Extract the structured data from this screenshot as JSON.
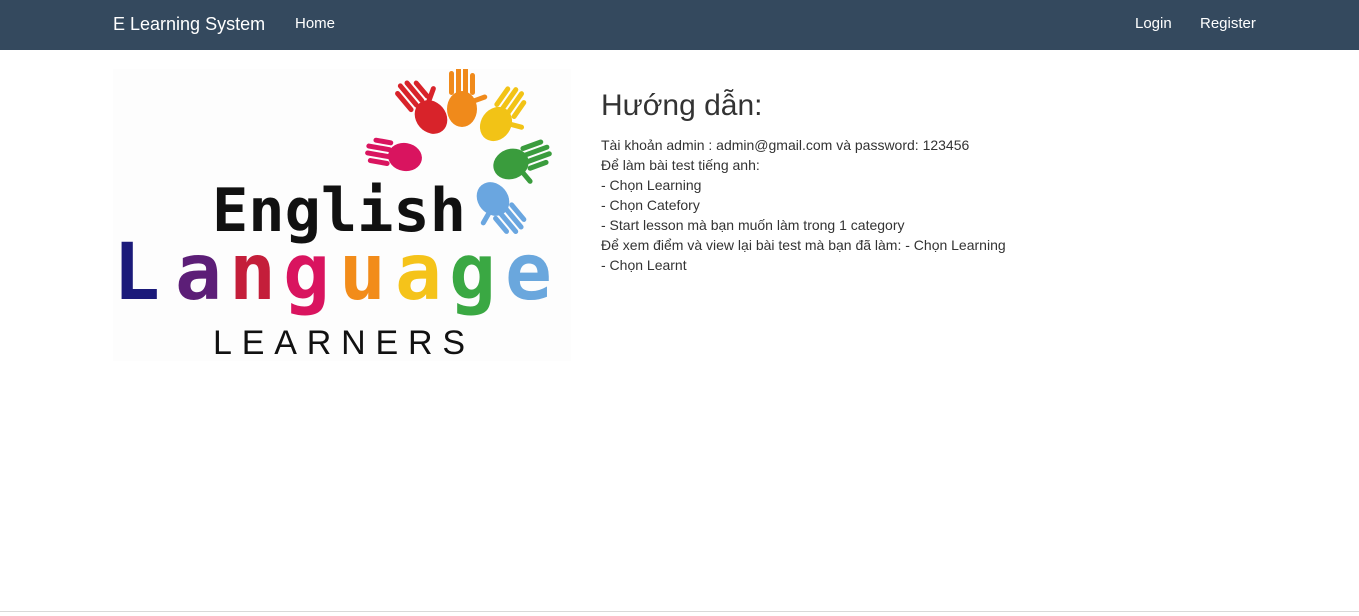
{
  "navbar": {
    "brand": "E Learning System",
    "home": "Home",
    "login": "Login",
    "register": "Register",
    "background_color": "#34495e"
  },
  "logo": {
    "word1": "English",
    "word2_letters": [
      "L",
      "a",
      "n",
      "g",
      "u",
      "a",
      "g",
      "e"
    ],
    "word3": "LEARNERS",
    "letter_colors": [
      "#1b1a7a",
      "#5c1e77",
      "#c41e3a",
      "#d9145f",
      "#f28c1a",
      "#f5c31a",
      "#3aa843",
      "#6aa7dd"
    ],
    "hand_colors": [
      "#d8232a",
      "#f08a1b",
      "#f2c316",
      "#3a9c3d",
      "#6aa6e0",
      "#d9145f"
    ]
  },
  "guide": {
    "title": "Hướng dẫn:",
    "lines": [
      "Tài khoản admin : admin@gmail.com và password: 123456",
      "Để làm bài test tiếng anh:",
      "- Chọn Learning",
      "- Chọn Catefory",
      "- Start lesson mà bạn muốn làm trong 1 category",
      "Để xem điểm và view lại bài test mà bạn đã làm: - Chọn Learning",
      "- Chọn Learnt"
    ]
  }
}
